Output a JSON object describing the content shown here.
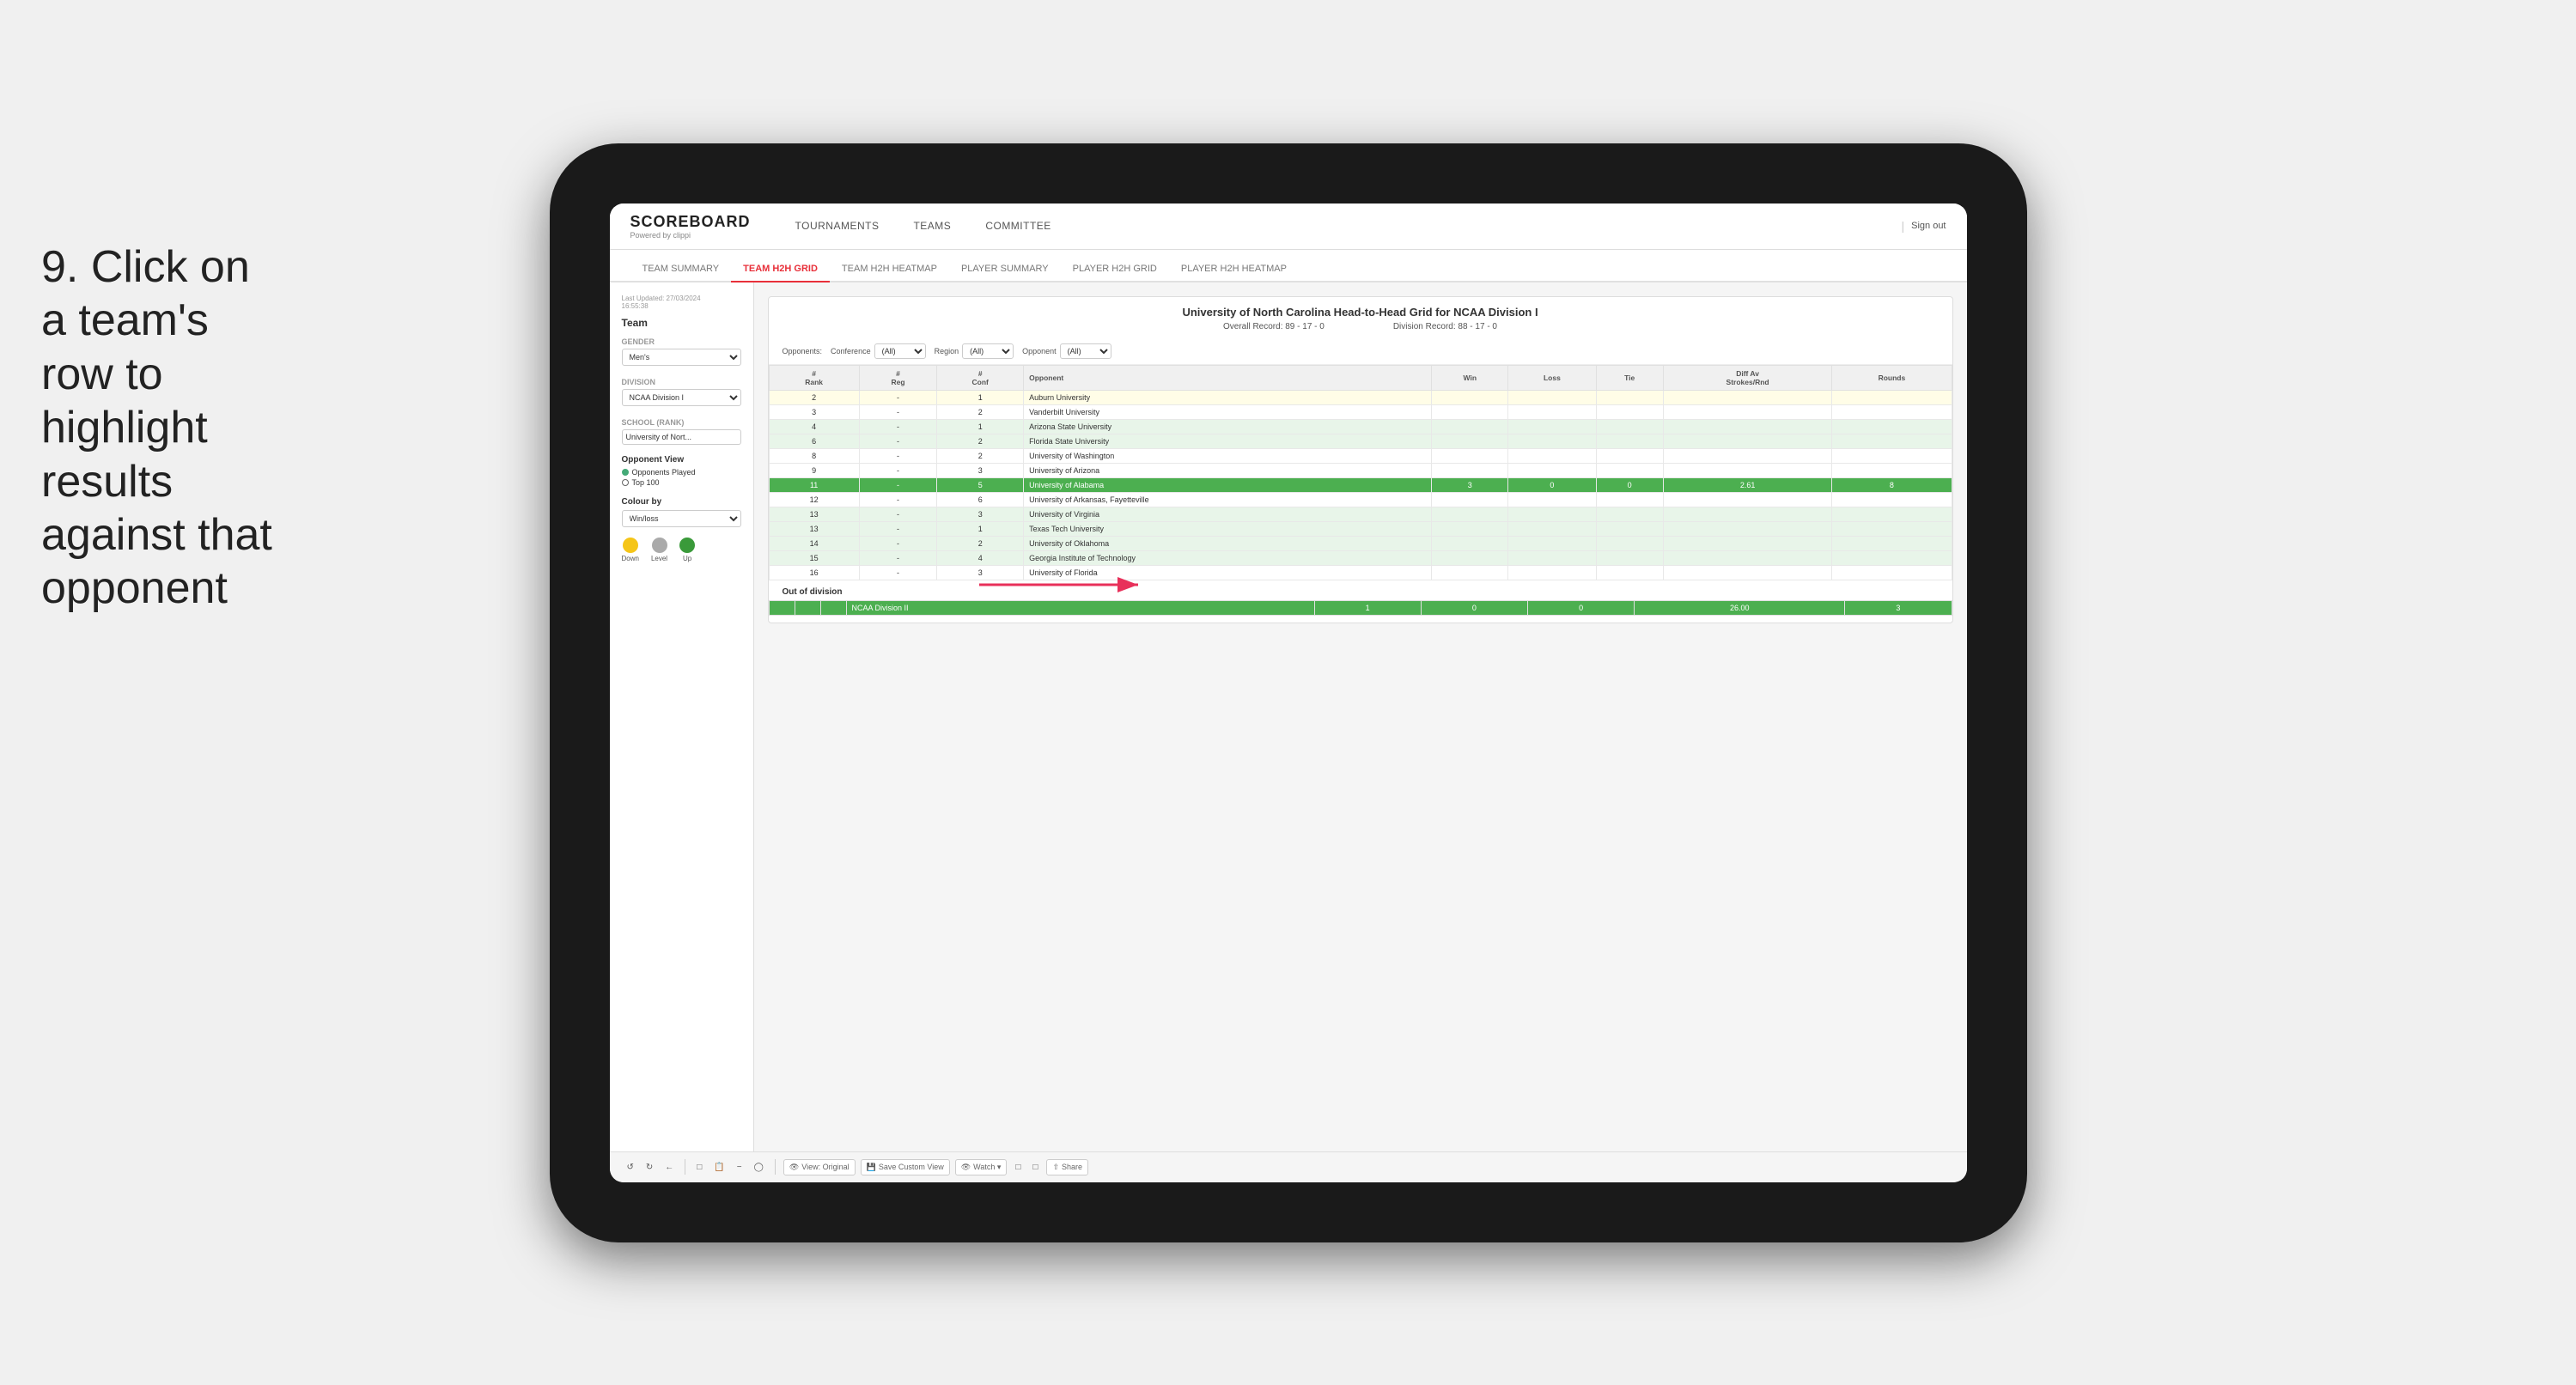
{
  "instruction": {
    "number": "9.",
    "text": "Click on a team's row to highlight results against that opponent"
  },
  "app": {
    "logo": "SCOREBOARD",
    "logo_sub": "Powered by clippi",
    "nav": [
      "TOURNAMENTS",
      "TEAMS",
      "COMMITTEE"
    ],
    "sign_out": "Sign out"
  },
  "sub_nav": [
    "TEAM SUMMARY",
    "TEAM H2H GRID",
    "TEAM H2H HEATMAP",
    "PLAYER SUMMARY",
    "PLAYER H2H GRID",
    "PLAYER H2H HEATMAP"
  ],
  "sub_nav_active": "TEAM H2H GRID",
  "sidebar": {
    "last_updated": "Last Updated: 27/03/2024",
    "last_updated_time": "16:55:38",
    "team_label": "Team",
    "gender_label": "Gender",
    "gender_value": "Men's",
    "division_label": "Division",
    "division_value": "NCAA Division I",
    "school_label": "School (Rank)",
    "school_value": "University of Nort...",
    "opponent_view_label": "Opponent View",
    "radio_opponents": "Opponents Played",
    "radio_top100": "Top 100",
    "colour_by_label": "Colour by",
    "colour_by_value": "Win/loss",
    "legend_down": "Down",
    "legend_level": "Level",
    "legend_up": "Up"
  },
  "grid": {
    "title": "University of North Carolina Head-to-Head Grid for NCAA Division I",
    "overall_record": "Overall Record: 89 - 17 - 0",
    "division_record": "Division Record: 88 - 17 - 0",
    "filters": {
      "opponents_label": "Opponents:",
      "conference_label": "Conference",
      "conference_value": "(All)",
      "region_label": "Region",
      "region_value": "(All)",
      "opponent_label": "Opponent",
      "opponent_value": "(All)"
    },
    "columns": [
      "#\nRank",
      "#\nReg",
      "#\nConf",
      "Opponent",
      "Win",
      "Loss",
      "Tie",
      "Diff Av\nStrokes/Rnd",
      "Rounds"
    ],
    "rows": [
      {
        "rank": "2",
        "reg": "-",
        "conf": "1",
        "opponent": "Auburn University",
        "win": "",
        "loss": "",
        "tie": "",
        "diff": "",
        "rounds": "",
        "style": "light-yellow"
      },
      {
        "rank": "3",
        "reg": "-",
        "conf": "2",
        "opponent": "Vanderbilt University",
        "win": "",
        "loss": "",
        "tie": "",
        "diff": "",
        "rounds": "",
        "style": "white"
      },
      {
        "rank": "4",
        "reg": "-",
        "conf": "1",
        "opponent": "Arizona State University",
        "win": "",
        "loss": "",
        "tie": "",
        "diff": "",
        "rounds": "",
        "style": "light-green"
      },
      {
        "rank": "6",
        "reg": "-",
        "conf": "2",
        "opponent": "Florida State University",
        "win": "",
        "loss": "",
        "tie": "",
        "diff": "",
        "rounds": "",
        "style": "light-green"
      },
      {
        "rank": "8",
        "reg": "-",
        "conf": "2",
        "opponent": "University of Washington",
        "win": "",
        "loss": "",
        "tie": "",
        "diff": "",
        "rounds": "",
        "style": "white"
      },
      {
        "rank": "9",
        "reg": "-",
        "conf": "3",
        "opponent": "University of Arizona",
        "win": "",
        "loss": "",
        "tie": "",
        "diff": "",
        "rounds": "",
        "style": "white"
      },
      {
        "rank": "11",
        "reg": "-",
        "conf": "5",
        "opponent": "University of Alabama",
        "win": "3",
        "loss": "0",
        "tie": "0",
        "diff": "2.61",
        "rounds": "8",
        "style": "highlighted"
      },
      {
        "rank": "12",
        "reg": "-",
        "conf": "6",
        "opponent": "University of Arkansas, Fayetteville",
        "win": "",
        "loss": "",
        "tie": "",
        "diff": "",
        "rounds": "",
        "style": "white"
      },
      {
        "rank": "13",
        "reg": "-",
        "conf": "3",
        "opponent": "University of Virginia",
        "win": "",
        "loss": "",
        "tie": "",
        "diff": "",
        "rounds": "",
        "style": "light-green"
      },
      {
        "rank": "13",
        "reg": "-",
        "conf": "1",
        "opponent": "Texas Tech University",
        "win": "",
        "loss": "",
        "tie": "",
        "diff": "",
        "rounds": "",
        "style": "light-green"
      },
      {
        "rank": "14",
        "reg": "-",
        "conf": "2",
        "opponent": "University of Oklahoma",
        "win": "",
        "loss": "",
        "tie": "",
        "diff": "",
        "rounds": "",
        "style": "light-green"
      },
      {
        "rank": "15",
        "reg": "-",
        "conf": "4",
        "opponent": "Georgia Institute of Technology",
        "win": "",
        "loss": "",
        "tie": "",
        "diff": "",
        "rounds": "",
        "style": "light-green"
      },
      {
        "rank": "16",
        "reg": "-",
        "conf": "3",
        "opponent": "University of Florida",
        "win": "",
        "loss": "",
        "tie": "",
        "diff": "",
        "rounds": "",
        "style": "white"
      }
    ],
    "out_of_division_label": "Out of division",
    "out_of_division_row": {
      "label": "NCAA Division II",
      "win": "1",
      "loss": "0",
      "tie": "0",
      "diff": "26.00",
      "rounds": "3"
    }
  },
  "toolbar": {
    "undo": "↩",
    "redo": "↪",
    "view_original": "View: Original",
    "save_custom": "Save Custom View",
    "watch": "Watch ▾",
    "share": "Share"
  }
}
